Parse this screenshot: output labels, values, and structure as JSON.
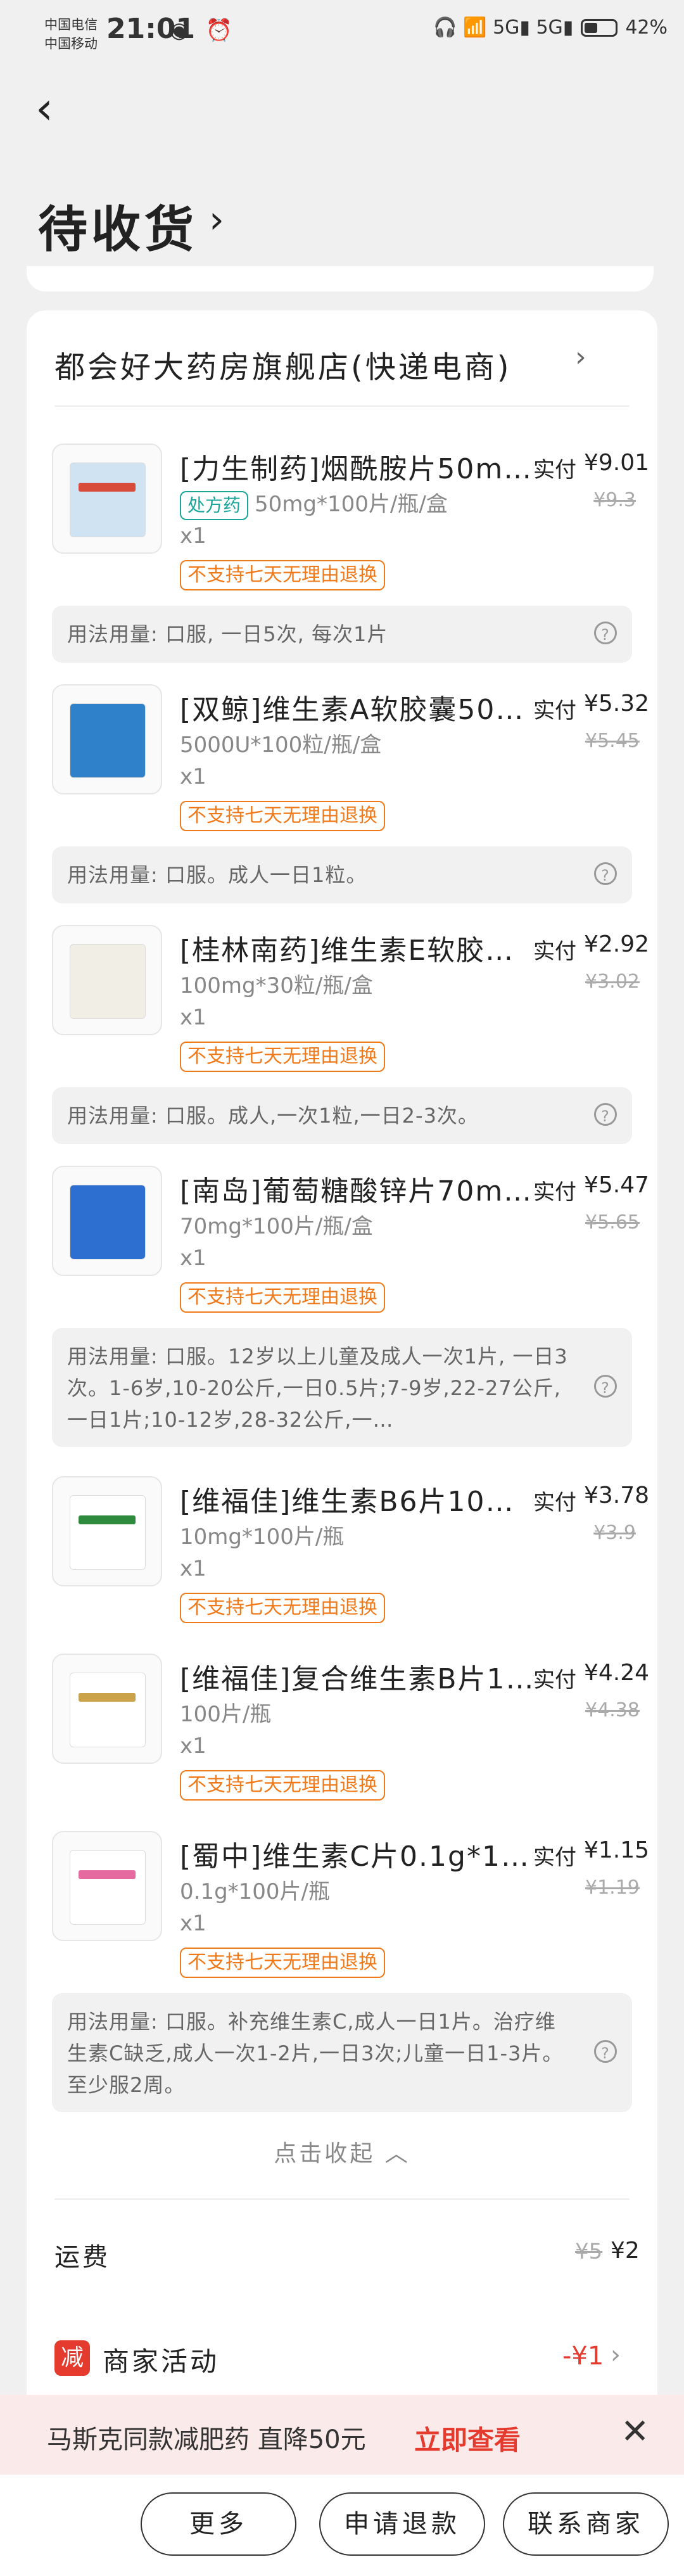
{
  "status_bar": {
    "carrier1": "中国电信",
    "carrier2": "中国移动",
    "time": "21:01",
    "left_icons": "◉ ⏰",
    "signal_icons": "🎧 📶 5G▮ 5G▮",
    "battery_pct": "42%",
    "battery_level": 0.42
  },
  "header": {
    "back_icon": "‹",
    "title": "待收货",
    "title_chevron": "›"
  },
  "store": {
    "name": "都会好大药房旗舰店(快递电商)",
    "chevron": "›"
  },
  "items": [
    {
      "name": "[力生制药]烟酰胺片50m…",
      "rx": "处方药",
      "spec": "50mg*100片/瓶/盒",
      "qty": "x1",
      "paid_label": "实付",
      "paid": "¥9.01",
      "orig": "¥9.3",
      "no_return": "不支持七天无理由退换",
      "usage": "用法用量: 口服, 一日5次, 每次1片",
      "pkg_color": "#cfe3f2"
    },
    {
      "name": "[双鲸]维生素A软胶囊50…",
      "rx": "",
      "spec": "5000U*100粒/瓶/盒",
      "qty": "x1",
      "paid_label": "实付",
      "paid": "¥5.32",
      "orig": "¥5.45",
      "no_return": "不支持七天无理由退换",
      "usage": "用法用量: 口服。成人一日1粒。",
      "pkg_color": "#2f82c9"
    },
    {
      "name": "[桂林南药]维生素E软胶…",
      "rx": "",
      "spec": "100mg*30粒/瓶/盒",
      "qty": "x1",
      "paid_label": "实付",
      "paid": "¥2.92",
      "orig": "¥3.02",
      "no_return": "不支持七天无理由退换",
      "usage": "用法用量: 口服。成人,一次1粒,一日2-3次。",
      "pkg_color": "#f1eee6"
    },
    {
      "name": "[南岛]葡萄糖酸锌片70m…",
      "rx": "",
      "spec": "70mg*100片/瓶/盒",
      "qty": "x1",
      "paid_label": "实付",
      "paid": "¥5.47",
      "orig": "¥5.65",
      "no_return": "不支持七天无理由退换",
      "usage": "用法用量: 口服。12岁以上儿童及成人一次1片, 一日3次。1-6岁,10-20公斤,一日0.5片;7-9岁,22-27公斤,一日1片;10-12岁,28-32公斤,一…",
      "pkg_color": "#2d6fd1"
    },
    {
      "name": "[维福佳]维生素B6片10mg…",
      "rx": "",
      "spec": "10mg*100片/瓶",
      "qty": "x1",
      "paid_label": "实付",
      "paid": "¥3.78",
      "orig": "¥3.9",
      "no_return": "不支持七天无理由退换",
      "usage": "",
      "pkg_color": "#ffffff"
    },
    {
      "name": "[维福佳]复合维生素B片1…",
      "rx": "",
      "spec": "100片/瓶",
      "qty": "x1",
      "paid_label": "实付",
      "paid": "¥4.24",
      "orig": "¥4.38",
      "no_return": "不支持七天无理由退换",
      "usage": "",
      "pkg_color": "#ffffff"
    },
    {
      "name": "[蜀中]维生素C片0.1g*100…",
      "rx": "",
      "spec": "0.1g*100片/瓶",
      "qty": "x1",
      "paid_label": "实付",
      "paid": "¥1.15",
      "orig": "¥1.19",
      "no_return": "不支持七天无理由退换",
      "usage": "用法用量: 口服。补充维生素C,成人一日1片。治疗维生素C缺乏,成人一次1-2片,一日3次;儿童一日1-3片。至少服2周。",
      "pkg_color": "#ffffff"
    }
  ],
  "collapse_label": "点击收起 ︿",
  "shipping": {
    "label": "运费",
    "orig": "¥5",
    "value": "¥2"
  },
  "promo": {
    "badge": "减",
    "label": "商家活动",
    "value": "-¥1",
    "chevron": "›"
  },
  "banner": {
    "text": "马斯克同款减肥药 直降50元",
    "cta": "立即查看",
    "close": "✕"
  },
  "bottom_buttons": [
    "更多",
    "申请退款",
    "联系商家"
  ]
}
